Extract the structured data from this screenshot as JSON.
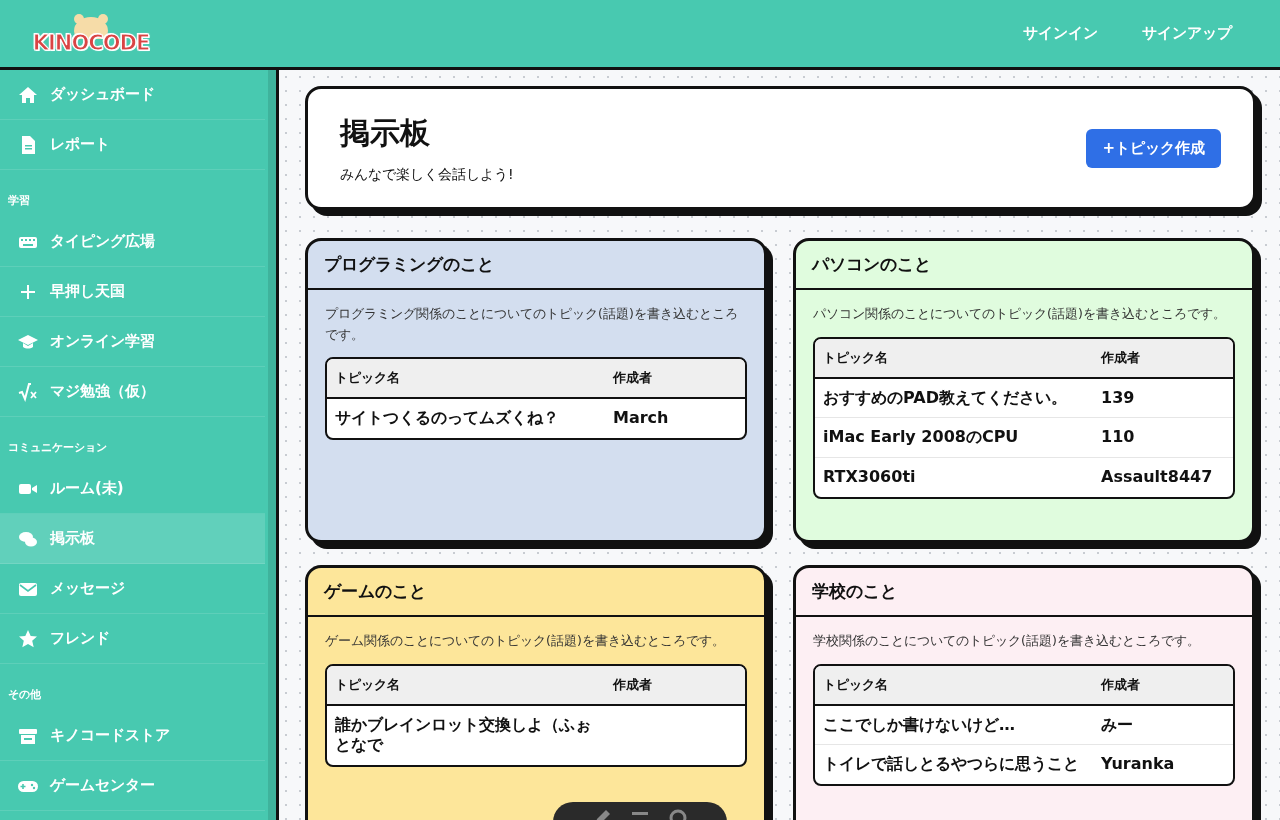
{
  "header": {
    "logo": "KINOCODE",
    "nav": [
      {
        "label": "サインイン"
      },
      {
        "label": "サインアップ"
      }
    ]
  },
  "sidebar": {
    "items": [
      {
        "kind": "item",
        "label": "ダッシュボード",
        "selected": false
      },
      {
        "kind": "item",
        "label": "レポート",
        "selected": false
      },
      {
        "kind": "section",
        "label": "学習"
      },
      {
        "kind": "item",
        "label": "タイピング広場",
        "selected": false
      },
      {
        "kind": "item",
        "label": "早押し天国",
        "selected": false
      },
      {
        "kind": "item",
        "label": "オンライン学習",
        "selected": false
      },
      {
        "kind": "item",
        "label": "マジ勉強（仮）",
        "selected": false
      },
      {
        "kind": "section",
        "label": "コミュニケーション"
      },
      {
        "kind": "item",
        "label": "ルーム(未)",
        "selected": false
      },
      {
        "kind": "item",
        "label": "掲示板",
        "selected": true
      },
      {
        "kind": "item",
        "label": "メッセージ",
        "selected": false
      },
      {
        "kind": "item",
        "label": "フレンド",
        "selected": false
      },
      {
        "kind": "section",
        "label": "その他"
      },
      {
        "kind": "item",
        "label": "キノコードストア",
        "selected": false
      },
      {
        "kind": "item",
        "label": "ゲームセンター",
        "selected": false
      }
    ]
  },
  "page": {
    "title": "掲示板",
    "subtitle": "みんなで楽しく会話しよう!",
    "button": "+トピック作成"
  },
  "boards": [
    {
      "title": "プログラミングのこと",
      "color": "#d3deef",
      "description": "プログラミング関係のことについてのトピック(話題)を書き込むところです。",
      "columns": [
        "トピック名",
        "作成者"
      ],
      "topics": [
        {
          "title": "サイトつくるのってムズくね？",
          "author": "March"
        }
      ]
    },
    {
      "title": "パソコンのこと",
      "color": "#e0fcde",
      "description": "パソコン関係のことについてのトピック(話題)を書き込むところです。",
      "columns": [
        "トピック名",
        "作成者"
      ],
      "topics": [
        {
          "title": "おすすめのPAD教えてください。",
          "author": "139"
        },
        {
          "title": "iMac Early 2008のCPU",
          "author": "110"
        },
        {
          "title": "RTX3060ti",
          "author": "Assault8447"
        }
      ]
    },
    {
      "title": "ゲームのこと",
      "color": "#fde69a",
      "description": "ゲーム関係のことについてのトピック(話題)を書き込むところです。",
      "columns": [
        "トピック名",
        "作成者"
      ],
      "topics": [
        {
          "title": "誰かブレインロット交換しよ（ふぉとなで"
        }
      ]
    },
    {
      "title": "学校のこと",
      "color": "#fdeff3",
      "description": "学校関係のことについてのトピック(話題)を書き込むところです。",
      "columns": [
        "トピック名",
        "作成者"
      ],
      "topics": [
        {
          "title": "ここでしか書けないけど…",
          "author": "みー"
        },
        {
          "title": "トイレで話しとるやつらに思うこと",
          "author": "Yuranka"
        }
      ]
    }
  ]
}
